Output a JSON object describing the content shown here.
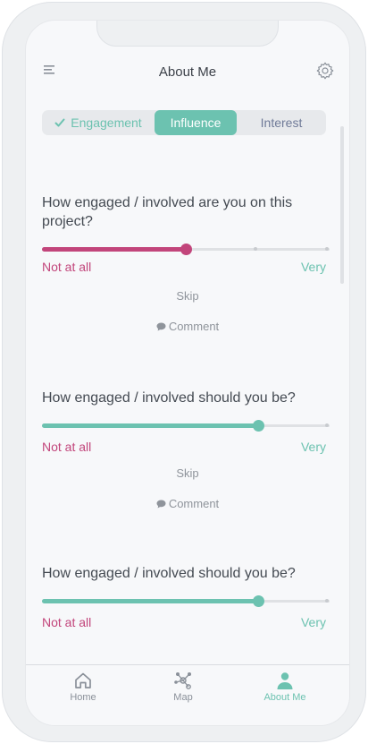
{
  "header": {
    "title": "About Me",
    "menu_icon": "menu-icon",
    "settings_icon": "gear-icon"
  },
  "tabs": [
    {
      "label": "Engagement",
      "state": "completed",
      "color": "#6cc2b0"
    },
    {
      "label": "Influence",
      "state": "active",
      "color": "#6cc2b0"
    },
    {
      "label": "Interest",
      "state": "inactive",
      "color": "#6f7a98"
    }
  ],
  "questions": [
    {
      "text": "How engaged / involved are you on  this project?",
      "value": 0.5,
      "fill_color": "#c2457b",
      "min_label": "Not at all",
      "max_label": "Very",
      "skip_label": "Skip",
      "comment_label": "Comment"
    },
    {
      "text": "How engaged / involved should you be?",
      "value": 0.75,
      "fill_color": "#6cc2b0",
      "min_label": "Not at all",
      "max_label": "Very",
      "skip_label": "Skip",
      "comment_label": "Comment"
    },
    {
      "text": "How engaged / involved should you be?",
      "value": 0.75,
      "fill_color": "#6cc2b0",
      "min_label": "Not at all",
      "max_label": "Very"
    }
  ],
  "nav": [
    {
      "label": "Home",
      "icon": "home-icon",
      "active": false
    },
    {
      "label": "Map",
      "icon": "network-icon",
      "active": false
    },
    {
      "label": "About Me",
      "icon": "person-icon",
      "active": true
    }
  ],
  "colors": {
    "accent": "#6cc2b0",
    "negative": "#c2457b",
    "muted": "#8f949b"
  }
}
